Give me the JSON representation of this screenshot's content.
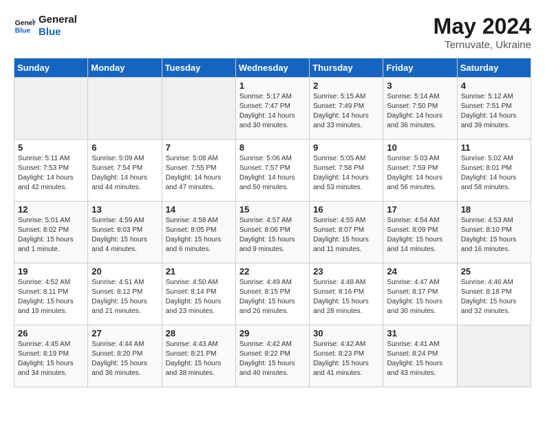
{
  "logo": {
    "line1": "General",
    "line2": "Blue"
  },
  "title": "May 2024",
  "subtitle": "Ternuvate, Ukraine",
  "days_of_week": [
    "Sunday",
    "Monday",
    "Tuesday",
    "Wednesday",
    "Thursday",
    "Friday",
    "Saturday"
  ],
  "weeks": [
    [
      {
        "num": "",
        "info": ""
      },
      {
        "num": "",
        "info": ""
      },
      {
        "num": "",
        "info": ""
      },
      {
        "num": "1",
        "info": "Sunrise: 5:17 AM\nSunset: 7:47 PM\nDaylight: 14 hours\nand 30 minutes."
      },
      {
        "num": "2",
        "info": "Sunrise: 5:15 AM\nSunset: 7:49 PM\nDaylight: 14 hours\nand 33 minutes."
      },
      {
        "num": "3",
        "info": "Sunrise: 5:14 AM\nSunset: 7:50 PM\nDaylight: 14 hours\nand 36 minutes."
      },
      {
        "num": "4",
        "info": "Sunrise: 5:12 AM\nSunset: 7:51 PM\nDaylight: 14 hours\nand 39 minutes."
      }
    ],
    [
      {
        "num": "5",
        "info": "Sunrise: 5:11 AM\nSunset: 7:53 PM\nDaylight: 14 hours\nand 42 minutes."
      },
      {
        "num": "6",
        "info": "Sunrise: 5:09 AM\nSunset: 7:54 PM\nDaylight: 14 hours\nand 44 minutes."
      },
      {
        "num": "7",
        "info": "Sunrise: 5:08 AM\nSunset: 7:55 PM\nDaylight: 14 hours\nand 47 minutes."
      },
      {
        "num": "8",
        "info": "Sunrise: 5:06 AM\nSunset: 7:57 PM\nDaylight: 14 hours\nand 50 minutes."
      },
      {
        "num": "9",
        "info": "Sunrise: 5:05 AM\nSunset: 7:58 PM\nDaylight: 14 hours\nand 53 minutes."
      },
      {
        "num": "10",
        "info": "Sunrise: 5:03 AM\nSunset: 7:59 PM\nDaylight: 14 hours\nand 56 minutes."
      },
      {
        "num": "11",
        "info": "Sunrise: 5:02 AM\nSunset: 8:01 PM\nDaylight: 14 hours\nand 58 minutes."
      }
    ],
    [
      {
        "num": "12",
        "info": "Sunrise: 5:01 AM\nSunset: 8:02 PM\nDaylight: 15 hours\nand 1 minute."
      },
      {
        "num": "13",
        "info": "Sunrise: 4:59 AM\nSunset: 8:03 PM\nDaylight: 15 hours\nand 4 minutes."
      },
      {
        "num": "14",
        "info": "Sunrise: 4:58 AM\nSunset: 8:05 PM\nDaylight: 15 hours\nand 6 minutes."
      },
      {
        "num": "15",
        "info": "Sunrise: 4:57 AM\nSunset: 8:06 PM\nDaylight: 15 hours\nand 9 minutes."
      },
      {
        "num": "16",
        "info": "Sunrise: 4:55 AM\nSunset: 8:07 PM\nDaylight: 15 hours\nand 11 minutes."
      },
      {
        "num": "17",
        "info": "Sunrise: 4:54 AM\nSunset: 8:09 PM\nDaylight: 15 hours\nand 14 minutes."
      },
      {
        "num": "18",
        "info": "Sunrise: 4:53 AM\nSunset: 8:10 PM\nDaylight: 15 hours\nand 16 minutes."
      }
    ],
    [
      {
        "num": "19",
        "info": "Sunrise: 4:52 AM\nSunset: 8:11 PM\nDaylight: 15 hours\nand 19 minutes."
      },
      {
        "num": "20",
        "info": "Sunrise: 4:51 AM\nSunset: 8:12 PM\nDaylight: 15 hours\nand 21 minutes."
      },
      {
        "num": "21",
        "info": "Sunrise: 4:50 AM\nSunset: 8:14 PM\nDaylight: 15 hours\nand 23 minutes."
      },
      {
        "num": "22",
        "info": "Sunrise: 4:49 AM\nSunset: 8:15 PM\nDaylight: 15 hours\nand 26 minutes."
      },
      {
        "num": "23",
        "info": "Sunrise: 4:48 AM\nSunset: 8:16 PM\nDaylight: 15 hours\nand 28 minutes."
      },
      {
        "num": "24",
        "info": "Sunrise: 4:47 AM\nSunset: 8:17 PM\nDaylight: 15 hours\nand 30 minutes."
      },
      {
        "num": "25",
        "info": "Sunrise: 4:46 AM\nSunset: 8:18 PM\nDaylight: 15 hours\nand 32 minutes."
      }
    ],
    [
      {
        "num": "26",
        "info": "Sunrise: 4:45 AM\nSunset: 8:19 PM\nDaylight: 15 hours\nand 34 minutes."
      },
      {
        "num": "27",
        "info": "Sunrise: 4:44 AM\nSunset: 8:20 PM\nDaylight: 15 hours\nand 36 minutes."
      },
      {
        "num": "28",
        "info": "Sunrise: 4:43 AM\nSunset: 8:21 PM\nDaylight: 15 hours\nand 38 minutes."
      },
      {
        "num": "29",
        "info": "Sunrise: 4:42 AM\nSunset: 8:22 PM\nDaylight: 15 hours\nand 40 minutes."
      },
      {
        "num": "30",
        "info": "Sunrise: 4:42 AM\nSunset: 8:23 PM\nDaylight: 15 hours\nand 41 minutes."
      },
      {
        "num": "31",
        "info": "Sunrise: 4:41 AM\nSunset: 8:24 PM\nDaylight: 15 hours\nand 43 minutes."
      },
      {
        "num": "",
        "info": ""
      }
    ]
  ]
}
